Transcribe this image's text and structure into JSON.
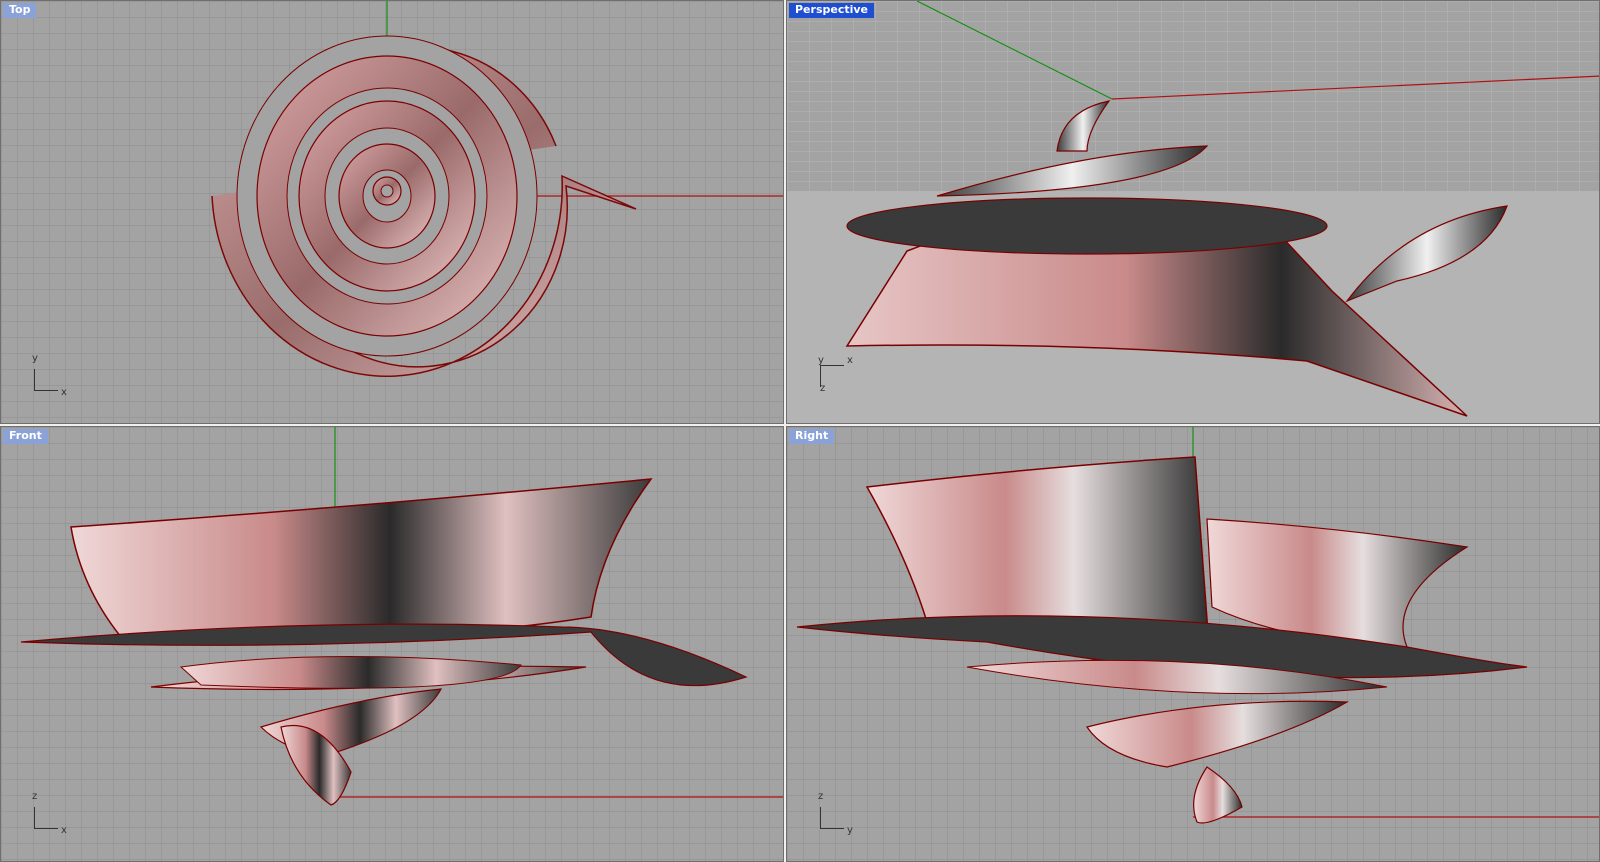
{
  "viewports": {
    "top": {
      "title": "Top",
      "axis_vertical": "y",
      "axis_horizontal": "x"
    },
    "persp": {
      "title": "Perspective",
      "axis_vertical": "y",
      "axis_horizontal": "x",
      "axis_depth": "z"
    },
    "front": {
      "title": "Front",
      "axis_vertical": "z",
      "axis_horizontal": "x"
    },
    "right": {
      "title": "Right",
      "axis_vertical": "z",
      "axis_horizontal": "y"
    }
  },
  "colors": {
    "viewport_bg": "#a3a3a3",
    "grid": "#8e8e8e",
    "grid_major": "#7a7a7a",
    "axis_x": "#b01010",
    "axis_y": "#129012",
    "surface_pink": "#c98a8a",
    "surface_dark": "#2a2a2a",
    "surface_light": "#f2e6e6",
    "curve": "#9a0000",
    "active_title": "#1f4fd1",
    "inactive_title": "#8aa2d8"
  },
  "icons": [
    "world-axes-icon",
    "control-point-icon"
  ]
}
